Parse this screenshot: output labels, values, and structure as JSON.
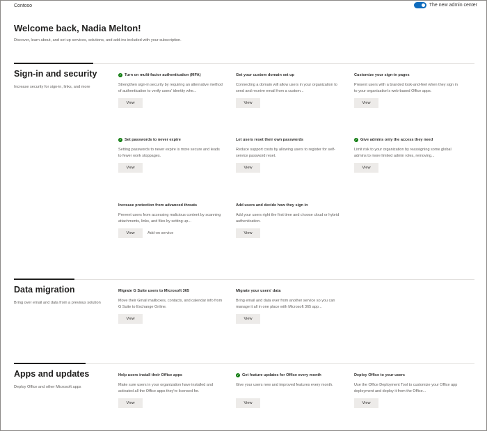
{
  "header": {
    "brand": "Contoso",
    "toggle_label": "The new admin center",
    "welcome": "Welcome back, Nadia Melton!",
    "subtitle": "Discover, learn about, and set up services, solutions, and add-ins included with your subscription."
  },
  "sections": [
    {
      "title": "Sign-in and security",
      "description": "Increase security for sign-in, links, and more",
      "cards": [
        {
          "title": "Turn on multi-factor authentication (MFA)",
          "done": true,
          "description": "Strengthen sign-in security by requiring an alternative method of authentication to verify users' identity whe...",
          "button": "View"
        },
        {
          "title": "Get your custom domain set up",
          "done": false,
          "description": "Connecting a domain will allow users in your organization to send and receive email from a custom...",
          "button": "View"
        },
        {
          "title": "Customize your sign-in pages",
          "done": false,
          "description": "Present users with a branded look-and-feel when they sign in to your organization's web-based Office apps.",
          "button": "View"
        },
        {
          "title": "Set passwords to never expire",
          "done": true,
          "description": "Setting passwords to never expire is more secure and leads to fewer work stoppages.",
          "button": "View"
        },
        {
          "title": "Let users reset their own passwords",
          "done": false,
          "description": "Reduce support costs by allowing users to register for self-service password reset.",
          "button": "View"
        },
        {
          "title": "Give admins only the access they need",
          "done": true,
          "description": "Limit risk to your organization by reassigning some global admins to more limited admin roles, removing...",
          "button": "View"
        },
        {
          "title": "Increase protection from advanced threats",
          "done": false,
          "description": "Prevent users from accessing malicious content by scanning attachments, links, and files by setting up...",
          "button": "View",
          "note": "Add-on service"
        },
        {
          "title": "Add users and decide how they sign in",
          "done": false,
          "description": "Add your users right the first time and choose cloud or hybrid authentication.",
          "button": "View"
        }
      ]
    },
    {
      "title": "Data migration",
      "description": "Bring over email and data from a previous solution",
      "cards": [
        {
          "title": "Migrate G Suite users to Microsoft 365",
          "done": false,
          "description": "Move their Gmail mailboxes, contacts, and calendar info from G Suite to Exchange Online.",
          "button": "View"
        },
        {
          "title": "Migrate your users' data",
          "done": false,
          "description": "Bring email and data over from another service so you can manage it all in one place with Microsoft 365 app...",
          "button": "View"
        }
      ]
    },
    {
      "title": "Apps and updates",
      "description": "Deploy Office and other Microsoft apps",
      "cards": [
        {
          "title": "Help users install their Office apps",
          "done": false,
          "description": "Make sure users in your organization have installed and activated all the Office apps they're licensed for.",
          "button": "View"
        },
        {
          "title": "Get feature updates for Office every month",
          "done": true,
          "description": "Give your users new and improved features every month.",
          "button": "View"
        },
        {
          "title": "Deploy Office to your users",
          "done": false,
          "description": "Use the Office Deployment Tool to customize your Office app deployment and deploy it from the Office...",
          "button": "View"
        }
      ]
    }
  ],
  "colors": {
    "accent": "#0f6cbd",
    "success": "#107c10",
    "button_bg": "#edebe9"
  }
}
